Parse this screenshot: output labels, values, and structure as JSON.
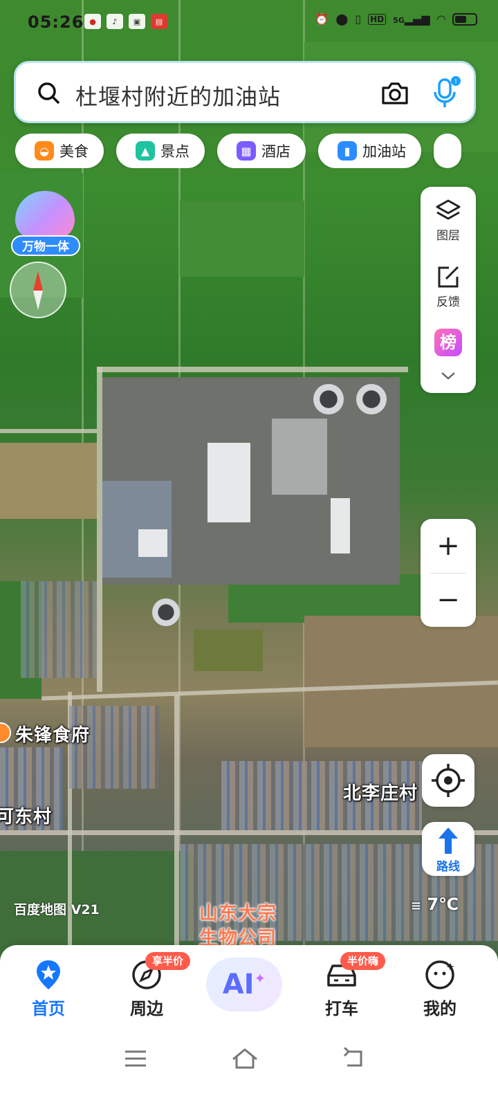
{
  "status_bar": {
    "time": "05:26",
    "network": "5G"
  },
  "search": {
    "query": "杜堰村附近的加油站"
  },
  "categories": [
    {
      "label": "美食",
      "icon": "food-icon",
      "color": "#ff8a1a"
    },
    {
      "label": "景点",
      "icon": "scenery-icon",
      "color": "#1fc3a0"
    },
    {
      "label": "酒店",
      "icon": "hotel-icon",
      "color": "#7a5cff"
    },
    {
      "label": "加油站",
      "icon": "gas-station-icon",
      "color": "#2b8cff"
    }
  ],
  "widgets": {
    "ad_label": "万物一体"
  },
  "tools": {
    "layers_label": "图层",
    "feedback_label": "反馈",
    "ranking_icon_text": "榜",
    "zoom_in": "+",
    "zoom_out": "−",
    "route_label": "路线"
  },
  "map_labels": {
    "poi_restaurant": "朱锋食府",
    "village_east": "北李庄村",
    "village_west": "可东村",
    "company_line1": "山东大宗",
    "company_line2": "生物公司",
    "watermark": "百度地图 V21",
    "temperature": "7℃"
  },
  "tabbar": {
    "tabs": [
      {
        "label": "首页",
        "active": true
      },
      {
        "label": "周边",
        "badge": "享半价"
      },
      {
        "label": "AI"
      },
      {
        "label": "打车",
        "badge": "半价嗨"
      },
      {
        "label": "我的"
      }
    ]
  }
}
